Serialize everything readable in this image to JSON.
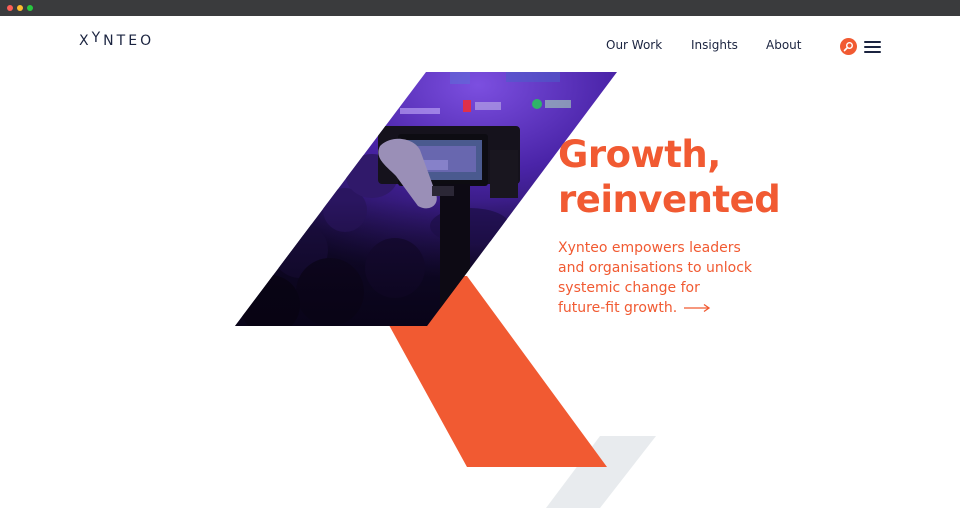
{
  "window": {
    "controls": [
      "close",
      "minimize",
      "zoom"
    ]
  },
  "header": {
    "logo_letters": [
      "X",
      "Y",
      "N",
      "T",
      "E",
      "O"
    ],
    "nav": [
      {
        "label": "Our Work"
      },
      {
        "label": "Insights"
      },
      {
        "label": "About"
      }
    ],
    "search_icon": "search-icon",
    "menu_icon": "hamburger-menu-icon"
  },
  "hero": {
    "headline_lines": [
      "Growth,",
      "reinvented"
    ],
    "lede_lines": [
      "Xynteo empowers leaders",
      "and organisations to unlock",
      "systemic change for",
      "future-fit growth."
    ],
    "arrow_icon": "arrow-right-icon"
  },
  "colors": {
    "accent": "#f15a32",
    "navy": "#1b2440",
    "light_grey": "#e8ebee",
    "photo_purple": "#3b1f82"
  }
}
